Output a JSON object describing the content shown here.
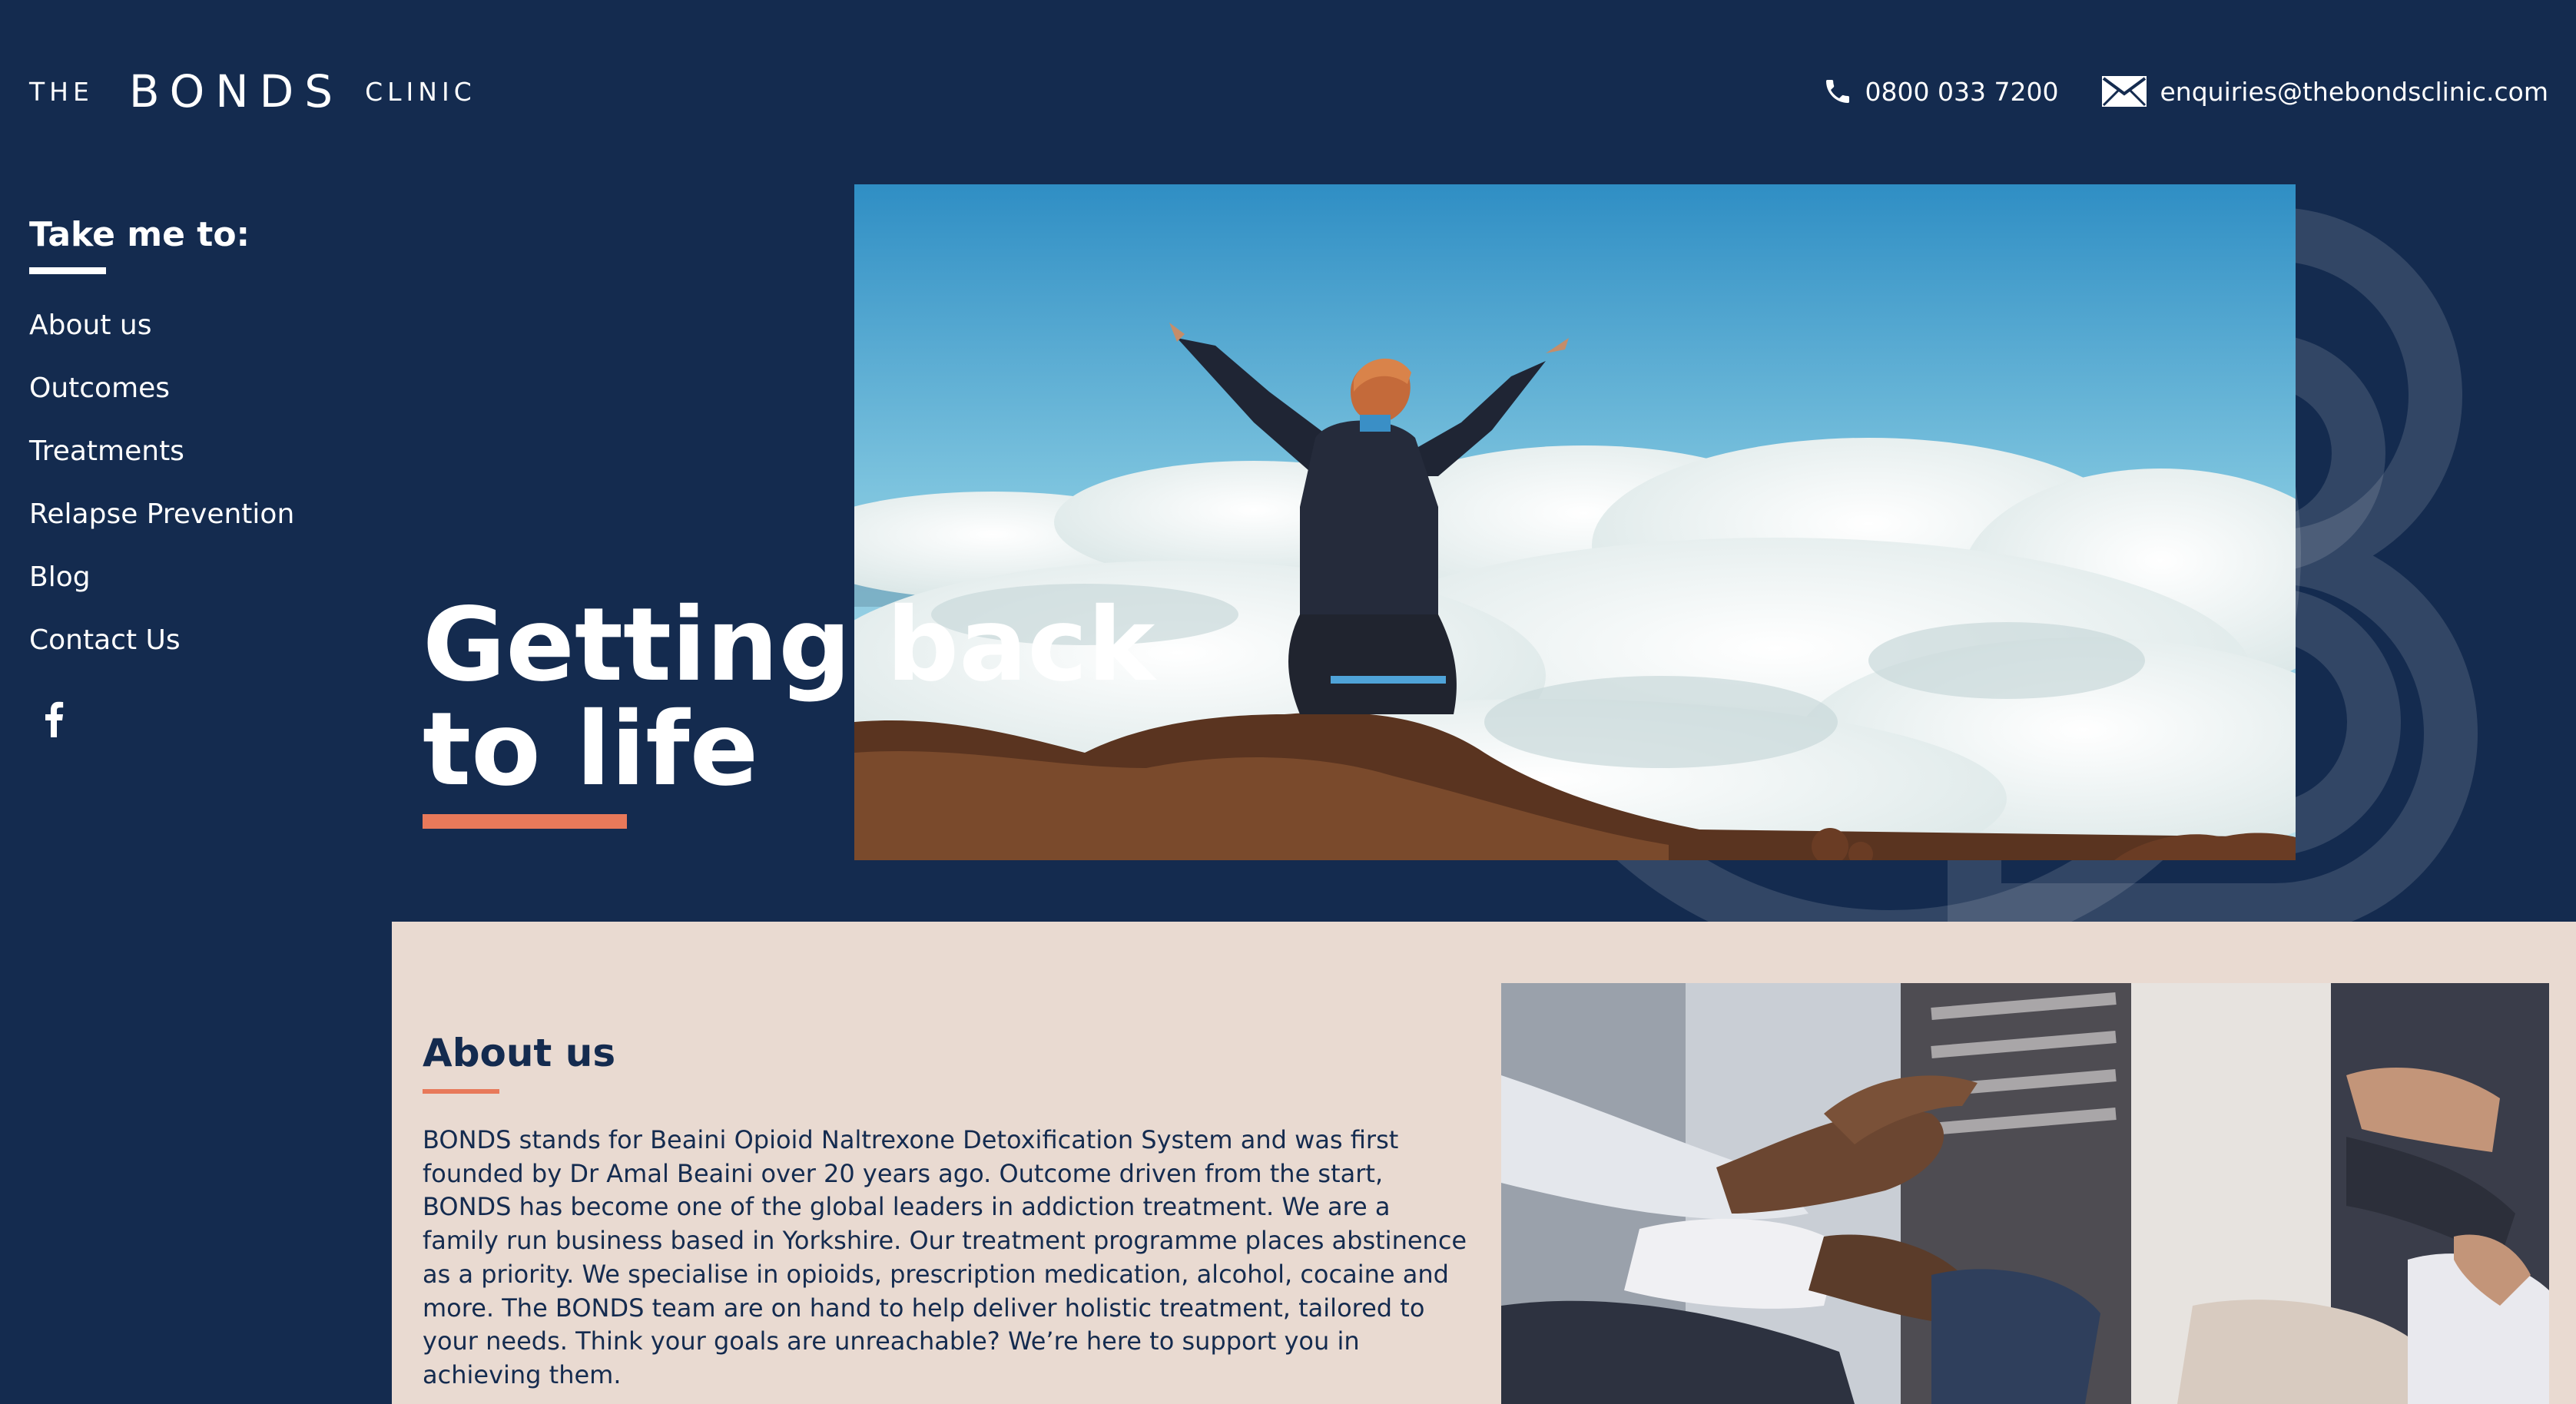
{
  "header": {
    "logo": {
      "the": "THE",
      "bonds": "BONDS",
      "clinic": "CLINIC"
    },
    "phone": "0800 033 7200",
    "email": "enquiries@thebondsclinic.com",
    "phone_icon": "phone-icon",
    "email_icon": "envelope-icon"
  },
  "sidebar": {
    "title": "Take me to:",
    "items": [
      {
        "label": "About us"
      },
      {
        "label": "Outcomes"
      },
      {
        "label": "Treatments"
      },
      {
        "label": "Relapse Prevention"
      },
      {
        "label": "Blog"
      },
      {
        "label": "Contact Us"
      }
    ],
    "social_icon": "facebook-icon"
  },
  "hero": {
    "title": "Getting back\nto life"
  },
  "about": {
    "title": "About us",
    "body": "BONDS stands for Beaini Opioid Naltrexone Detoxification System and was first founded by Dr Amal Beaini over 20 years ago. Outcome driven from the start, BONDS has become one of the global leaders in addiction treatment. We are a family run business based in Yorkshire. Our treatment programme places abstinence as a priority. We specialise in opioids, prescription medication, alcohol, cocaine and more. The BONDS team are on hand to help deliver holistic treatment, tailored to your needs. Think your goals are unreachable? We’re here to support you in achieving them."
  },
  "colors": {
    "navy": "#142b4f",
    "accent": "#e8795a",
    "about_bg": "#e9dad1"
  }
}
